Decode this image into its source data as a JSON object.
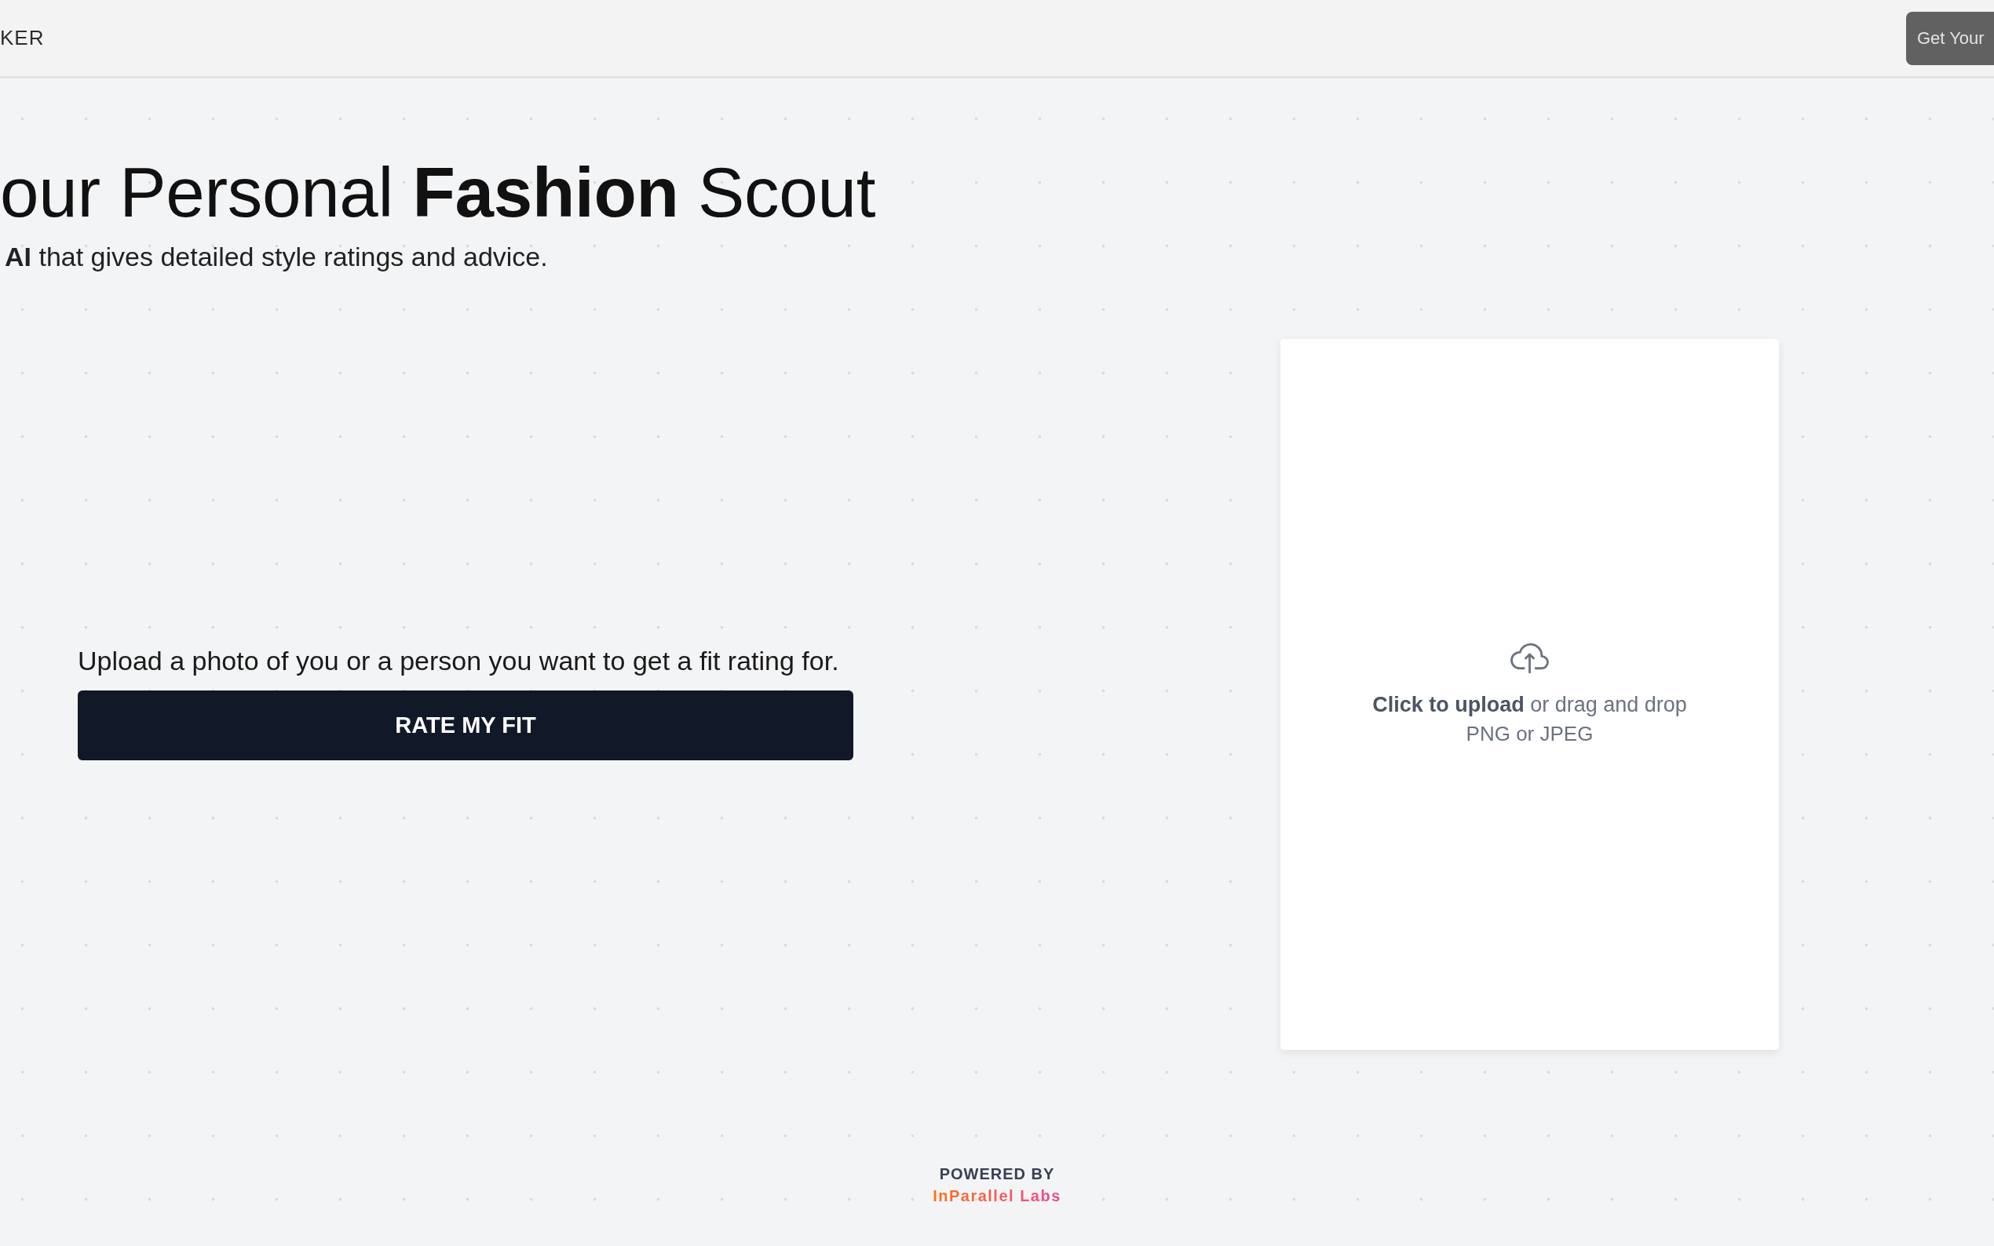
{
  "header": {
    "brand": "KER",
    "cta_button": "Get Your"
  },
  "hero": {
    "title": "our Personal **Fashion** Scout",
    "subtitle": "**AI** that gives detailed style ratings and advice."
  },
  "rate_panel": {
    "instructions": "Upload a photo of you or a person you want to get a fit rating for.",
    "button": "RATE MY FIT"
  },
  "upload_dropzone": {
    "prompt": "**Click to upload** or drag and drop",
    "hint": "PNG or JPEG"
  },
  "footer": {
    "powered_by": "POWERED BY",
    "company": "InParallel Labs"
  }
}
